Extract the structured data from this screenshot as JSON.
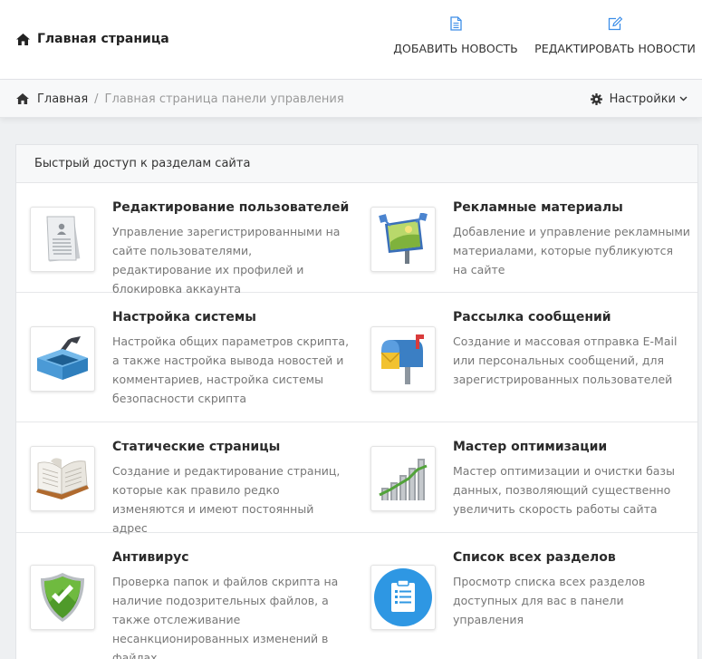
{
  "header": {
    "title": "Главная страница",
    "actions": [
      {
        "label": "ДОБАВИТЬ НОВОСТЬ",
        "icon": "file-text-icon"
      },
      {
        "label": "РЕДАКТИРОВАТЬ НОВОСТИ",
        "icon": "edit-icon"
      }
    ]
  },
  "breadcrumb": {
    "home": "Главная",
    "separator": "/",
    "current": "Главная страница панели управления",
    "settings": "Настройки"
  },
  "panel": {
    "title": "Быстрый доступ к разделам сайта",
    "items": [
      {
        "title": "Редактирование пользователей",
        "desc": "Управление зарегистрированными на сайте пользователями, редактирование их профилей и блокировка аккаунта",
        "icon": "user-document-icon"
      },
      {
        "title": "Рекламные материалы",
        "desc": "Добавление и управление рекламными материалами, которые публикуются на сайте",
        "icon": "billboard-icon"
      },
      {
        "title": "Настройка системы",
        "desc": "Настройка общих параметров скрипта, а также настройка вывода новостей и комментариев, настройка системы безопасности скрипта",
        "icon": "toolbox-icon"
      },
      {
        "title": "Рассылка сообщений",
        "desc": "Создание и массовая отправка E-Mail или персональных сообщений, для зарегистрированных пользователей",
        "icon": "mailbox-icon"
      },
      {
        "title": "Статические страницы",
        "desc": "Создание и редактирование страниц, которые как правило редко изменяются и имеют постоянный адрес",
        "icon": "open-book-icon"
      },
      {
        "title": "Мастер оптимизации",
        "desc": "Мастер оптимизации и очистки базы данных, позволяющий существенно увеличить скорость работы сайта",
        "icon": "bar-chart-icon"
      },
      {
        "title": "Антивирус",
        "desc": "Проверка папок и файлов скрипта на наличие подозрительных файлов, а также отслеживание несанкционированных изменений в файлах",
        "icon": "shield-check-icon"
      },
      {
        "title": "Список всех разделов",
        "desc": "Просмотр списка всех разделов доступных для вас в панели управления",
        "icon": "clipboard-list-icon"
      }
    ]
  },
  "colors": {
    "accent": "#3d8ee8",
    "shield": "#5aa02c",
    "text": "#333333",
    "muted": "#777777"
  }
}
